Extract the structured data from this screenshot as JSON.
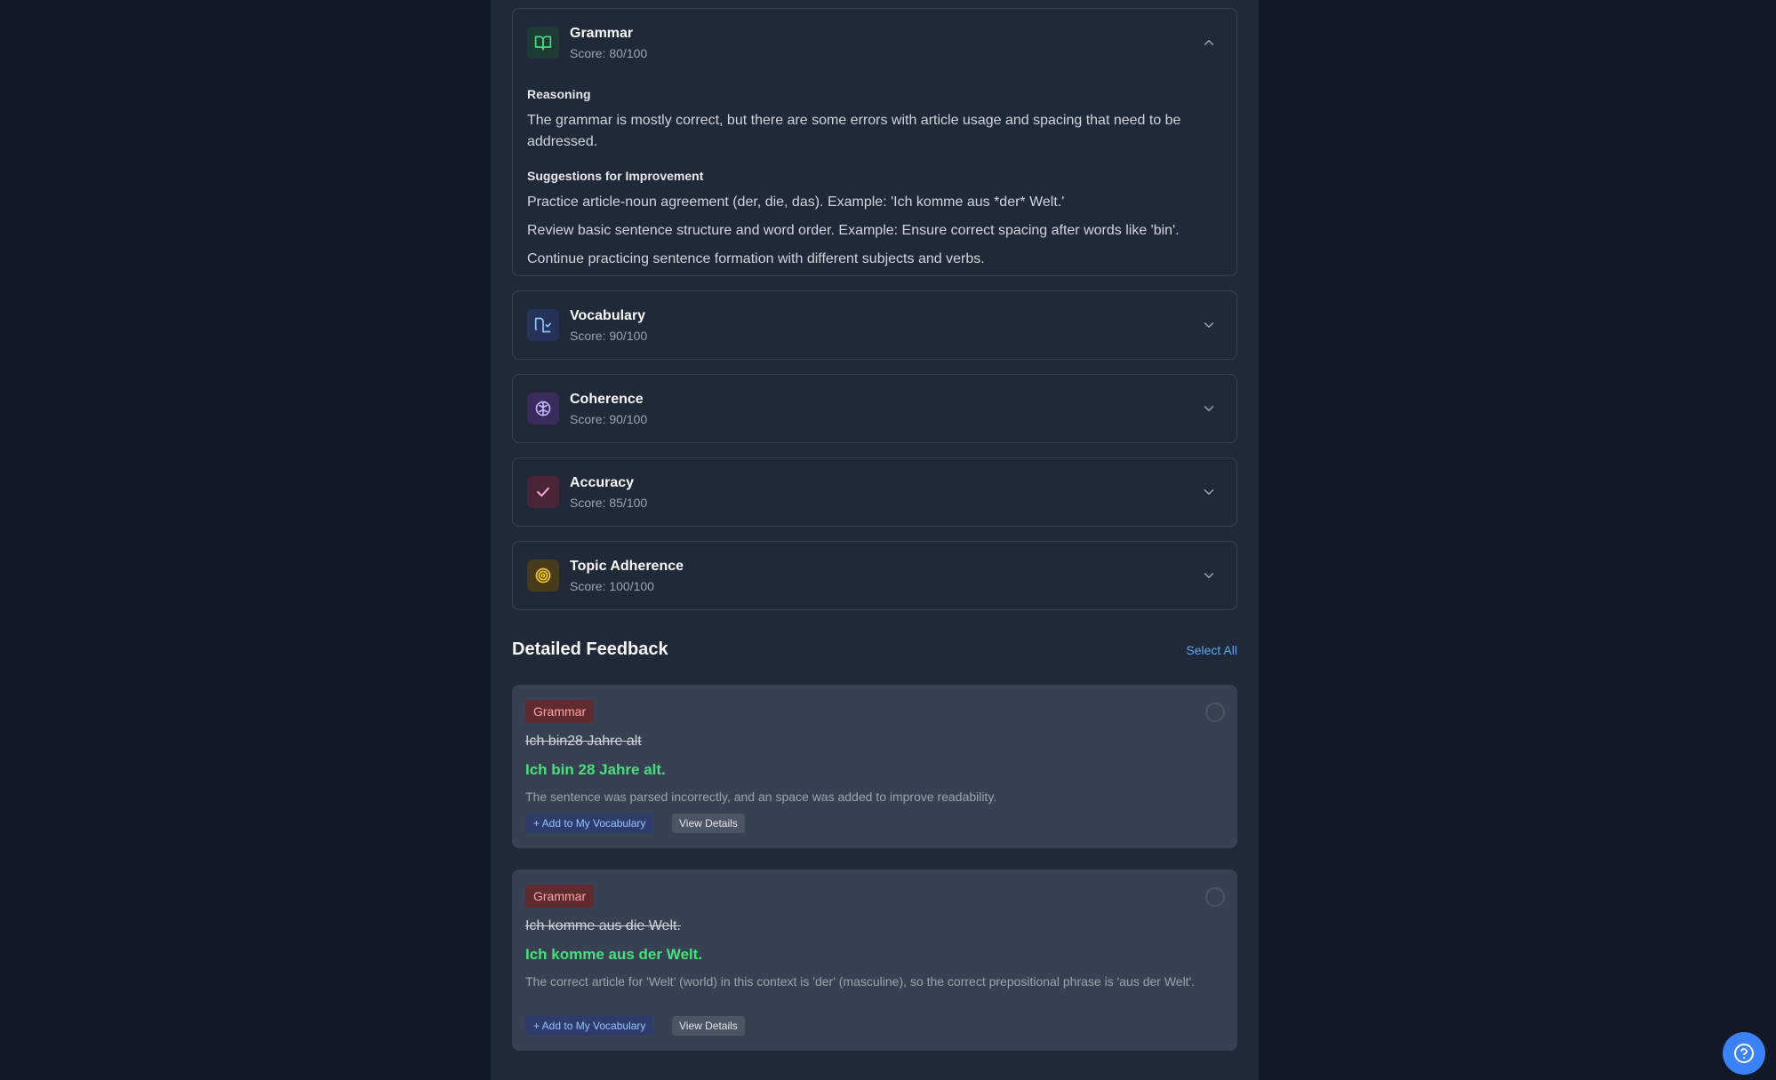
{
  "colors": {
    "background": "#111827",
    "panel": "#1f2937",
    "accent_blue": "#3b82f6",
    "correct_green": "#4ade80",
    "grammar_badge_bg": "#5f2b2f"
  },
  "criteria": [
    {
      "title": "Grammar",
      "score": "Score: 80/100",
      "icon": "book-open-icon",
      "expanded": true,
      "reasoning_label": "Reasoning",
      "reasoning": "The grammar is mostly correct, but there are some errors with article usage and spacing that need to be addressed.",
      "suggestions_label": "Suggestions for Improvement",
      "suggestions": [
        "Practice article-noun agreement (der, die, das). Example: 'Ich komme aus *der* Welt.'",
        "Review basic sentence structure and word order. Example: Ensure correct spacing after words like 'bin'.",
        "Continue practicing sentence formation with different subjects and verbs."
      ]
    },
    {
      "title": "Vocabulary",
      "score": "Score: 90/100",
      "icon": "book-check-icon",
      "expanded": false
    },
    {
      "title": "Coherence",
      "score": "Score: 90/100",
      "icon": "brain-icon",
      "expanded": false
    },
    {
      "title": "Accuracy",
      "score": "Score: 85/100",
      "icon": "check-icon",
      "expanded": false
    },
    {
      "title": "Topic Adherence",
      "score": "Score: 100/100",
      "icon": "target-icon",
      "expanded": false
    }
  ],
  "feedback": {
    "title": "Detailed Feedback",
    "select_all": "Select All",
    "items": [
      {
        "category": "Grammar",
        "original": "Ich bin28 Jahre alt",
        "corrected": "Ich bin 28 Jahre alt.",
        "explanation": "The sentence was parsed incorrectly, and an space was added to improve readability.",
        "add_label": "+ Add to My Vocabulary",
        "details_label": "View Details"
      },
      {
        "category": "Grammar",
        "original": "Ich komme aus die Welt.",
        "corrected": "Ich komme aus der Welt.",
        "explanation": "The correct article for 'Welt' (world) in this context is 'der' (masculine), so the correct prepositional phrase is 'aus der Welt'.",
        "add_label": "+ Add to My Vocabulary",
        "details_label": "View Details"
      }
    ]
  },
  "help_icon": "help-circle-icon"
}
